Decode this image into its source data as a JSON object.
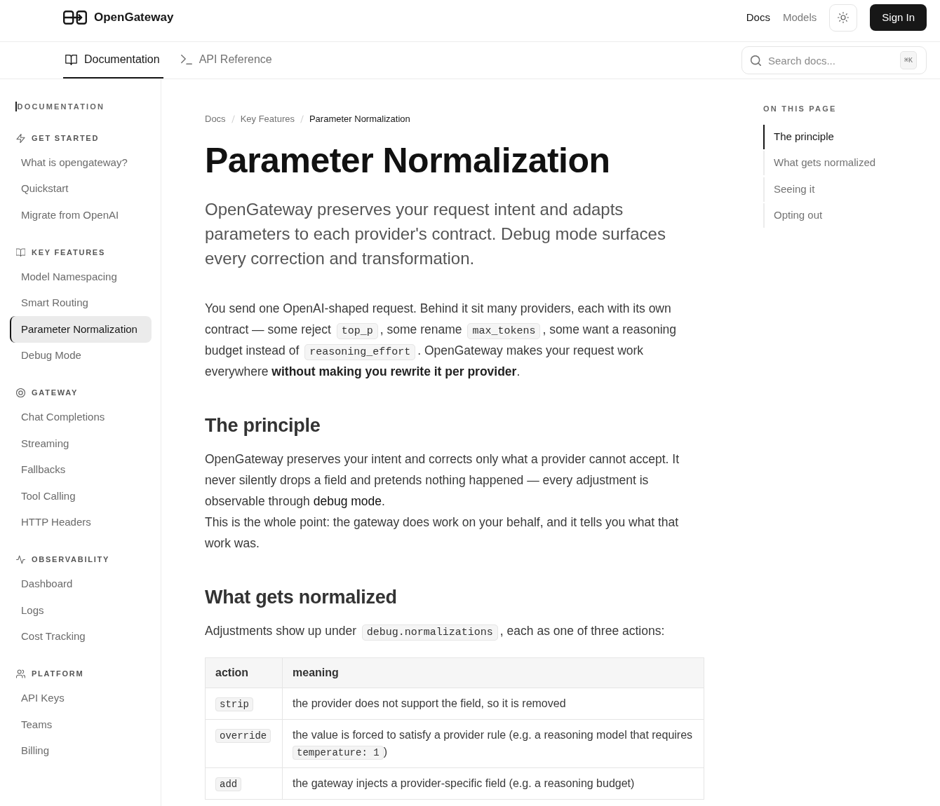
{
  "header": {
    "brand": "OpenGateway",
    "nav": [
      {
        "label": "Docs",
        "selected": true
      },
      {
        "label": "Models",
        "selected": false
      }
    ],
    "sign_in": "Sign In"
  },
  "tabs": [
    {
      "label": "Documentation",
      "selected": true
    },
    {
      "label": "API Reference",
      "selected": false
    }
  ],
  "search": {
    "placeholder": "Search docs...",
    "shortcut": "⌘K"
  },
  "sidebar": {
    "title": "DOCUMENTATION",
    "sections": [
      {
        "title": "GET STARTED",
        "items": [
          {
            "label": "What is opengateway?",
            "selected": false
          },
          {
            "label": "Quickstart",
            "selected": false
          },
          {
            "label": "Migrate from OpenAI",
            "selected": false
          }
        ]
      },
      {
        "title": "KEY FEATURES",
        "items": [
          {
            "label": "Model Namespacing",
            "selected": false
          },
          {
            "label": "Smart Routing",
            "selected": false
          },
          {
            "label": "Parameter Normalization",
            "selected": true
          },
          {
            "label": "Debug Mode",
            "selected": false
          }
        ]
      },
      {
        "title": "GATEWAY",
        "items": [
          {
            "label": "Chat Completions",
            "selected": false
          },
          {
            "label": "Streaming",
            "selected": false
          },
          {
            "label": "Fallbacks",
            "selected": false
          },
          {
            "label": "Tool Calling",
            "selected": false
          },
          {
            "label": "HTTP Headers",
            "selected": false
          }
        ]
      },
      {
        "title": "OBSERVABILITY",
        "items": [
          {
            "label": "Dashboard",
            "selected": false
          },
          {
            "label": "Logs",
            "selected": false
          },
          {
            "label": "Cost Tracking",
            "selected": false
          }
        ]
      },
      {
        "title": "PLATFORM",
        "items": [
          {
            "label": "API Keys",
            "selected": false
          },
          {
            "label": "Teams",
            "selected": false
          },
          {
            "label": "Billing",
            "selected": false
          }
        ]
      }
    ]
  },
  "article": {
    "breadcrumb": [
      {
        "label": "Docs",
        "current": false
      },
      {
        "label": "Key Features",
        "current": false
      },
      {
        "label": "Parameter Normalization",
        "current": true
      }
    ],
    "title": "Parameter Normalization",
    "lead": "OpenGateway preserves your request intent and adapts parameters to each provider's contract. Debug mode surfaces every correction and transformation.",
    "blocks": [
      {
        "kind": "paragraph",
        "segments": [
          {
            "kind": "text",
            "text": "You send one OpenAI-shaped request. Behind it sit many providers, each with its own contract — some reject "
          },
          {
            "kind": "code",
            "text": "top_p"
          },
          {
            "kind": "text",
            "text": ", some rename "
          },
          {
            "kind": "code",
            "text": "max_tokens"
          },
          {
            "kind": "text",
            "text": ", some want a reasoning budget instead of "
          },
          {
            "kind": "code",
            "text": "reasoning_effort"
          },
          {
            "kind": "text",
            "text": ". OpenGateway makes your request work everywhere **without making you rewrite it per provider**."
          }
        ]
      },
      {
        "kind": "heading",
        "text": "The principle"
      },
      {
        "kind": "paragraph",
        "segments": [
          {
            "kind": "text",
            "text": "OpenGateway preserves your intent and corrects only what a provider cannot accept. It never silently drops a field and pretends nothing happened — every adjustment is observable through "
          },
          {
            "kind": "link",
            "text": "debug mode"
          },
          {
            "kind": "text",
            "text": "."
          }
        ]
      },
      {
        "kind": "paragraph",
        "segments": [
          {
            "kind": "text",
            "text": "This is the whole point: the gateway does work on your behalf, and it tells you what that work was."
          }
        ]
      },
      {
        "kind": "heading",
        "text": "What gets normalized"
      },
      {
        "kind": "paragraph",
        "segments": [
          {
            "kind": "text",
            "text": "Adjustments show up under "
          },
          {
            "kind": "code",
            "text": "debug.normalizations"
          },
          {
            "kind": "text",
            "text": ", each as one of three actions:"
          }
        ]
      },
      {
        "kind": "table",
        "columns": [
          "action",
          "meaning"
        ],
        "rows": [
          [
            [
              {
                "kind": "code",
                "text": "strip"
              }
            ],
            [
              {
                "kind": "text",
                "text": "the provider does not support the field, so it is removed"
              }
            ]
          ],
          [
            [
              {
                "kind": "code",
                "text": "override"
              }
            ],
            [
              {
                "kind": "text",
                "text": "the value is forced to satisfy a provider rule (e.g. a reasoning model that requires "
              },
              {
                "kind": "code",
                "text": "temperature: 1"
              },
              {
                "kind": "text",
                "text": ")"
              }
            ]
          ],
          [
            [
              {
                "kind": "code",
                "text": "add"
              }
            ],
            [
              {
                "kind": "text",
                "text": "the gateway injects a provider-specific field (e.g. a reasoning budget)"
              }
            ]
          ]
        ]
      }
    ]
  },
  "toc": {
    "title": "ON THIS PAGE",
    "items": [
      {
        "label": "The principle",
        "selected": true
      },
      {
        "label": "What gets normalized",
        "selected": false
      },
      {
        "label": "Seeing it",
        "selected": false
      },
      {
        "label": "Opting out",
        "selected": false
      }
    ]
  }
}
